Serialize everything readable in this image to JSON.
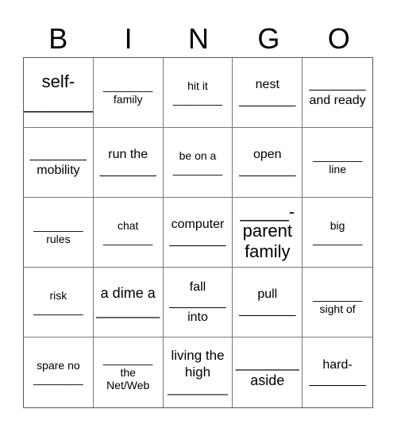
{
  "header": {
    "letters": [
      "B",
      "I",
      "N",
      "G",
      "O"
    ]
  },
  "blank": "________",
  "cells": [
    {
      "lines": [
        "self-",
        "________"
      ]
    },
    {
      "lines": [
        "________",
        "family"
      ]
    },
    {
      "lines": [
        "hit it",
        "________"
      ]
    },
    {
      "lines": [
        "nest",
        "________"
      ]
    },
    {
      "lines": [
        "________",
        "and ready"
      ]
    },
    {
      "lines": [
        "________",
        "mobility"
      ]
    },
    {
      "lines": [
        "run the",
        "________"
      ]
    },
    {
      "lines": [
        "be on a",
        "________"
      ]
    },
    {
      "lines": [
        "open",
        "________"
      ]
    },
    {
      "lines": [
        "________",
        "line"
      ]
    },
    {
      "lines": [
        "________",
        "rules"
      ]
    },
    {
      "lines": [
        "chat",
        "________"
      ]
    },
    {
      "lines": [
        "computer",
        "________"
      ]
    },
    {
      "lines": [
        "_____-",
        "parent",
        "family"
      ]
    },
    {
      "lines": [
        "big",
        "________"
      ]
    },
    {
      "lines": [
        "risk",
        "________"
      ]
    },
    {
      "lines": [
        "a dime a",
        "________"
      ]
    },
    {
      "lines": [
        "fall",
        "________",
        "into"
      ]
    },
    {
      "lines": [
        "pull",
        "________"
      ]
    },
    {
      "lines": [
        "________",
        "sight of"
      ]
    },
    {
      "lines": [
        "spare no",
        "________"
      ]
    },
    {
      "lines": [
        "________",
        "the",
        "Net/Web"
      ]
    },
    {
      "lines": [
        "living the",
        "high",
        "________"
      ]
    },
    {
      "lines": [
        "________",
        "aside"
      ]
    },
    {
      "lines": [
        "hard-",
        "________"
      ]
    }
  ]
}
